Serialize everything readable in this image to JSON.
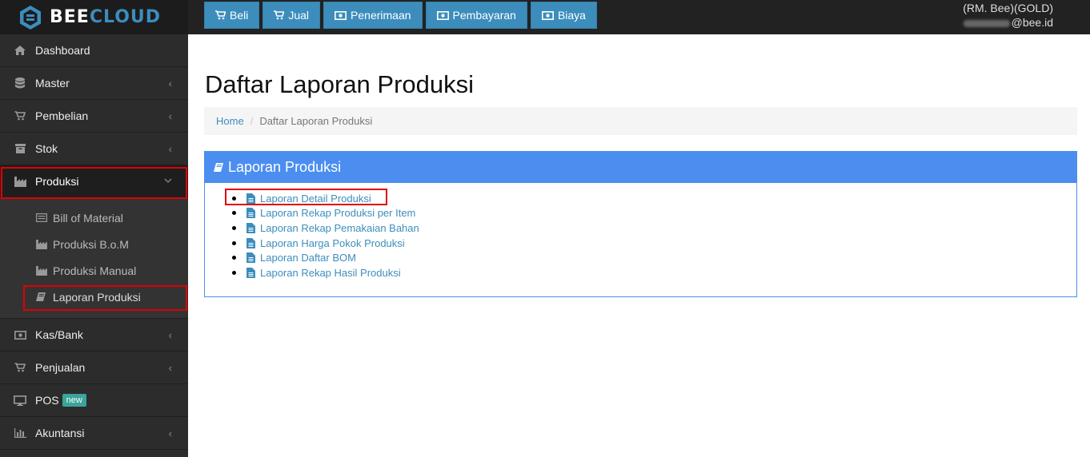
{
  "brand": {
    "part1": "BEE",
    "part2": "CLOUD"
  },
  "topnav": [
    {
      "label": "Beli",
      "icon": "cart-icon"
    },
    {
      "label": "Jual",
      "icon": "cart-icon"
    },
    {
      "label": "Penerimaan",
      "icon": "money-icon"
    },
    {
      "label": "Pembayaran",
      "icon": "money-icon"
    },
    {
      "label": "Biaya",
      "icon": "money-icon"
    }
  ],
  "user": {
    "company": "(RM. Bee)(GOLD)",
    "email_domain": "@bee.id"
  },
  "sidebar": {
    "items": [
      {
        "label": "Dashboard",
        "icon": "home-icon"
      },
      {
        "label": "Master",
        "icon": "database-icon"
      },
      {
        "label": "Pembelian",
        "icon": "cart-icon"
      },
      {
        "label": "Stok",
        "icon": "box-icon"
      },
      {
        "label": "Produksi",
        "icon": "factory-icon"
      },
      {
        "label": "Kas/Bank",
        "icon": "money-icon"
      },
      {
        "label": "Penjualan",
        "icon": "cart-icon"
      },
      {
        "label": "POS",
        "icon": "monitor-icon",
        "badge": "new"
      },
      {
        "label": "Akuntansi",
        "icon": "bar-chart-icon"
      }
    ],
    "produksi_sub": [
      {
        "label": "Bill of Material",
        "icon": "list-icon"
      },
      {
        "label": "Produksi B.o.M",
        "icon": "factory-icon"
      },
      {
        "label": "Produksi Manual",
        "icon": "factory-icon"
      },
      {
        "label": "Laporan Produksi",
        "icon": "book-icon"
      }
    ]
  },
  "page": {
    "title": "Daftar Laporan Produksi",
    "breadcrumb": {
      "home": "Home",
      "current": "Daftar Laporan Produksi"
    }
  },
  "panel": {
    "title": "Laporan Produksi",
    "reports": [
      "Laporan Detail Produksi",
      "Laporan Rekap Produksi per Item",
      "Laporan Rekap Pemakaian Bahan",
      "Laporan Harga Pokok Produksi",
      "Laporan Daftar BOM",
      "Laporan Rekap Hasil Produksi"
    ]
  },
  "colors": {
    "accent": "#3c8dbc",
    "panel_header": "#4b8ef0",
    "highlight": "#e00000",
    "sidebar": "#2c2c2c",
    "topbar": "#222222"
  }
}
